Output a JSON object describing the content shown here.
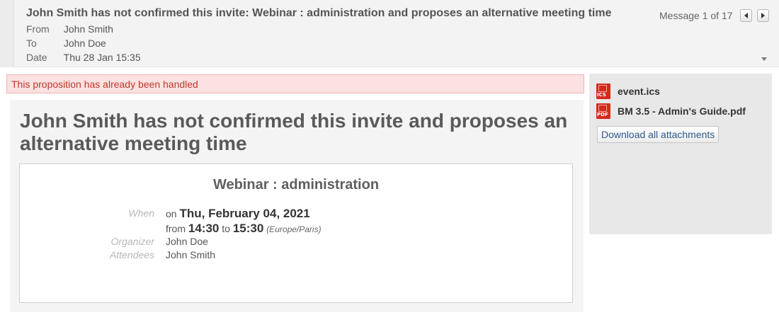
{
  "header": {
    "subject": "John Smith has not confirmed this invite: Webinar : administration and proposes an alternative meeting time",
    "from_label": "From",
    "from_value": "John Smith",
    "to_label": "To",
    "to_value": "John Doe",
    "date_label": "Date",
    "date_value": "Thu 28 Jan 15:35",
    "message_counter": "Message 1 of 17",
    "prev_icon": "triangle-left-icon",
    "next_icon": "triangle-right-icon",
    "expand_icon": "chevron-down-icon"
  },
  "alert": {
    "text": "This proposition has already been handled",
    "color": "#c0392b",
    "background": "#fbe1e1"
  },
  "main": {
    "title": "John Smith has not confirmed this invite and proposes an alternative meeting time"
  },
  "event": {
    "title": "Webinar : administration",
    "when_label": "When",
    "on_word": "on",
    "date": "Thu, February 04, 2021",
    "from_word": "from",
    "start_time": "14:30",
    "to_word": "to",
    "end_time": "15:30",
    "timezone": "(Europe/Paris)",
    "organizer_label": "Organizer",
    "organizer": "John Doe",
    "attendees_label": "Attendees",
    "attendees": "John Smith"
  },
  "attachments": {
    "items": [
      {
        "icon": "ics-file-icon",
        "badge": "ICS",
        "name": "event.ics"
      },
      {
        "icon": "pdf-file-icon",
        "badge": "PDF",
        "name": "BM 3.5 - Admin's Guide.pdf"
      }
    ],
    "download_all_label": "Download all attachments",
    "icon_color": "#d32a1d"
  }
}
